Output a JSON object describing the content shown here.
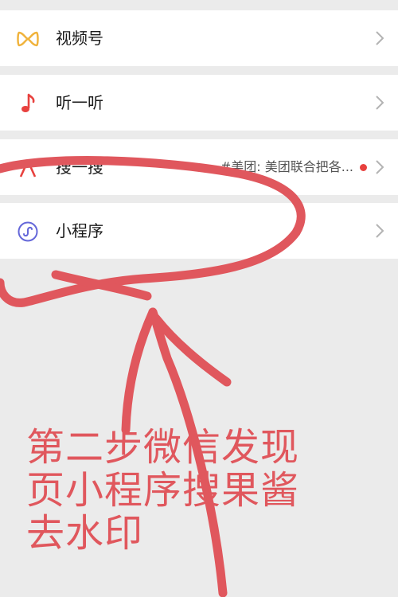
{
  "menu": {
    "items": [
      {
        "label": "视频号",
        "icon": "channels-icon"
      },
      {
        "label": "听一听",
        "icon": "music-note-icon"
      },
      {
        "label": "搜一搜",
        "icon": "search-star-icon",
        "extra": "#美团: 美团联合把各..."
      },
      {
        "label": "小程序",
        "icon": "mini-program-icon"
      }
    ]
  },
  "annotation": {
    "text": "第二步微信发现页小程序搜果酱去水印"
  },
  "colors": {
    "annotation_red": "#e0575d",
    "channels_gold": "#f0b23a",
    "music_red": "#e8413e",
    "mini_program_purple": "#6467d9"
  }
}
